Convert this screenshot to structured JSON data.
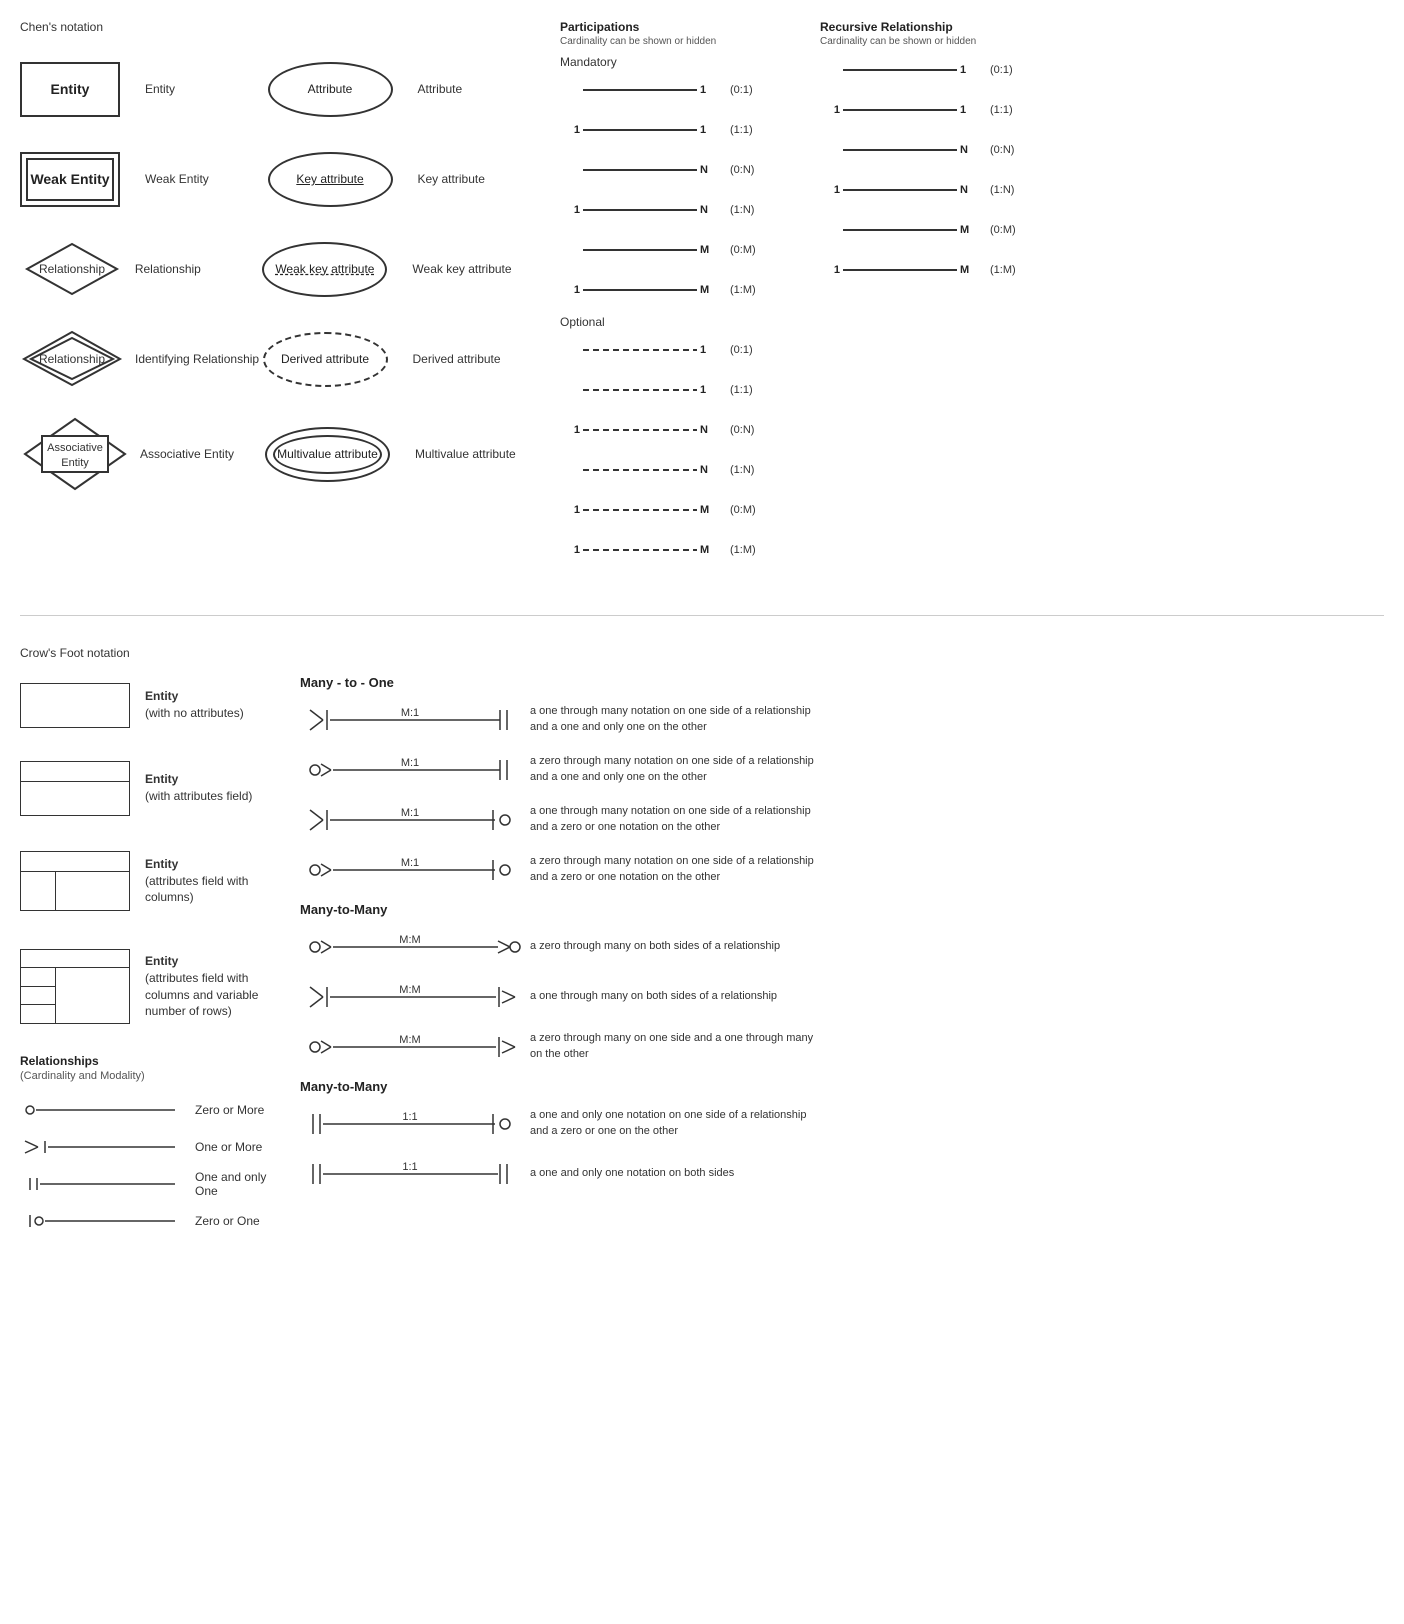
{
  "chens": {
    "title": "Chen's notation",
    "rows": [
      {
        "shape": "entity",
        "shapeLabel": "Entity",
        "description": "Entity",
        "attrShape": "ellipse",
        "attrLabel": "Attribute",
        "attrDescription": "Attribute"
      },
      {
        "shape": "weak-entity",
        "shapeLabel": "Weak Entity",
        "description": "Weak Entity",
        "attrShape": "key-ellipse",
        "attrLabel": "Key attribute",
        "attrDescription": "Key attribute"
      },
      {
        "shape": "diamond",
        "shapeLabel": "Relationship",
        "description": "Relationship",
        "attrShape": "weak-key-ellipse",
        "attrLabel": "Weak key attribute",
        "attrDescription": "Weak key attribute"
      },
      {
        "shape": "double-diamond",
        "shapeLabel": "Relationship",
        "description": "Identifying Relationship",
        "attrShape": "derived-ellipse",
        "attrLabel": "Derived attribute",
        "attrDescription": "Derived attribute"
      },
      {
        "shape": "associative",
        "shapeLabel": "Associative Entity",
        "description": "Associative Entity",
        "attrShape": "multivalue-ellipse",
        "attrLabel": "Multivalue attribute",
        "attrDescription": "Multivalue attribute"
      }
    ]
  },
  "participations": {
    "title": "Participations",
    "subtitle": "Cardinality can be shown or hidden",
    "mandatory_label": "Mandatory",
    "optional_label": "Optional",
    "mandatory_rows": [
      {
        "left": "",
        "right": "1",
        "notation": "(0:1)"
      },
      {
        "left": "1",
        "right": "1",
        "notation": "(1:1)"
      },
      {
        "left": "",
        "right": "N",
        "notation": "(0:N)"
      },
      {
        "left": "1",
        "right": "N",
        "notation": "(1:N)"
      },
      {
        "left": "",
        "right": "M",
        "notation": "(0:M)"
      },
      {
        "left": "1",
        "right": "M",
        "notation": "(1:M)"
      }
    ],
    "optional_rows": [
      {
        "left": "",
        "right": "1",
        "notation": "(0:1)"
      },
      {
        "left": "",
        "right": "1",
        "notation": "(1:1)"
      },
      {
        "left": "1",
        "right": "N",
        "notation": "(0:N)"
      },
      {
        "left": "",
        "right": "N",
        "notation": "(1:N)"
      },
      {
        "left": "1",
        "right": "M",
        "notation": "(0:M)"
      },
      {
        "left": "1",
        "right": "M",
        "notation": "(1:M)"
      }
    ]
  },
  "recursive": {
    "title": "Recursive Relationship",
    "subtitle": "Cardinality can be shown or hidden",
    "rows": [
      {
        "left": "",
        "right": "1",
        "notation": "(0:1)"
      },
      {
        "left": "1",
        "right": "1",
        "notation": "(1:1)"
      },
      {
        "left": "",
        "right": "N",
        "notation": "(0:N)"
      },
      {
        "left": "1",
        "right": "N",
        "notation": "(1:N)"
      },
      {
        "left": "",
        "right": "M",
        "notation": "(0:M)"
      },
      {
        "left": "1",
        "right": "M",
        "notation": "(1:M)"
      }
    ]
  },
  "crows": {
    "title": "Crow's Foot notation",
    "entities": [
      {
        "type": "basic",
        "label": "Entity",
        "sublabel": "(with no attributes)"
      },
      {
        "type": "attr",
        "label": "Entity",
        "sublabel": "(with attributes field)"
      },
      {
        "type": "columns",
        "label": "Entity",
        "sublabel": "(attributes field with columns)"
      },
      {
        "type": "var",
        "label": "Entity",
        "sublabel": "(attributes field with columns and variable number of rows)"
      }
    ],
    "relationships_title": "Relationships",
    "relationships_subtitle": "(Cardinality and Modality)",
    "rel_rows": [
      {
        "type": "zero-more",
        "label": "Zero or More"
      },
      {
        "type": "one-more",
        "label": "One or More"
      },
      {
        "type": "one-only",
        "label": "One and only One"
      },
      {
        "type": "zero-one",
        "label": "Zero or One"
      }
    ],
    "many_to_one_title": "Many - to - One",
    "m1_rows": [
      {
        "ratio": "M:1",
        "left_type": "crow-one-more",
        "right_type": "one-only",
        "desc": "a one through many notation on one side of a relationship and a one and only one on the other"
      },
      {
        "ratio": "M:1",
        "left_type": "crow-zero-more",
        "right_type": "one-only",
        "desc": "a zero through many notation on one side of a relationship and a one and only one on the other"
      },
      {
        "ratio": "M:1",
        "left_type": "crow-one-more",
        "right_type": "zero-one",
        "desc": "a one through many notation on one side of a relationship and a zero or one notation on the other"
      },
      {
        "ratio": "M:1",
        "left_type": "crow-zero-more",
        "right_type": "zero-one",
        "desc": "a zero through many notation on one side of a relationship and a zero or one notation on the other"
      }
    ],
    "many_to_many_title": "Many-to-Many",
    "mm_rows": [
      {
        "ratio": "M:M",
        "left_type": "crow-zero-more",
        "right_type": "crow-zero-more-r",
        "desc": "a zero through many on both sides of a relationship"
      },
      {
        "ratio": "M:M",
        "left_type": "crow-one-more",
        "right_type": "crow-one-more-r",
        "desc": "a one through many on both sides of a relationship"
      },
      {
        "ratio": "M:M",
        "left_type": "crow-zero-more",
        "right_type": "crow-one-more-r",
        "desc": "a zero through many on one side and a one through many on the other"
      }
    ],
    "many_to_many2_title": "Many-to-Many",
    "oneone_rows": [
      {
        "ratio": "1:1",
        "left_type": "one-only-l",
        "right_type": "zero-one-r",
        "desc": "a one and only one notation on one side of a relationship and a zero or one on the other"
      },
      {
        "ratio": "1:1",
        "left_type": "one-only-l",
        "right_type": "one-only-r",
        "desc": "a one and only one notation on both sides"
      }
    ]
  }
}
